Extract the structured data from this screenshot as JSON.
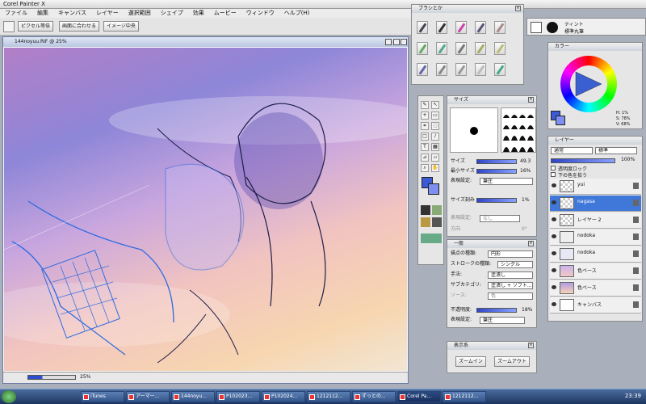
{
  "app": {
    "title": "Corel Painter X"
  },
  "menu": [
    "ファイル",
    "編集",
    "キャンバス",
    "レイヤー",
    "選択範囲",
    "シェイプ",
    "効果",
    "ムービー",
    "ウィンドウ",
    "ヘルプ(H)"
  ],
  "property_bar": {
    "btn1": "ピクセル等倍",
    "btn2": "画面に合わせる",
    "btn3": "イメージ中央"
  },
  "canvas": {
    "title": "144noyuu.RIF @ 25%",
    "zoom": "25%"
  },
  "brush_panel": {
    "title": "ブラシとか"
  },
  "dabs": {
    "label1": "ティント",
    "label2": "標準丸筆"
  },
  "size_panel": {
    "title": "サイズ",
    "size_label": "サイズ",
    "size_value": "49.3",
    "minsize_label": "最小サイズ",
    "minsize_value": "16%",
    "expr_label": "表現設定:",
    "expr_value": "筆圧",
    "minsize_pct": "最小サイズ",
    "sizestep_label": "サイズ刻み",
    "sizestep_value": "1%",
    "angle_label": "方向",
    "dir_label": "表現設定:",
    "dir_value": "なし",
    "angle_value": "0°"
  },
  "general_panel": {
    "title": "一般",
    "dab_label": "描点の種類:",
    "dab_value": "円形",
    "stroke_label": "ストロークの種類:",
    "stroke_value": "シングル",
    "method_label": "手法:",
    "method_value": "塗潰し",
    "subcat_label": "サブカテゴリ:",
    "subcat_value": "塗潰し + ソフト...",
    "source_label": "ソース:",
    "source_value": "色",
    "opacity_label": "不透明度:",
    "opacity_value": "18%",
    "opexpr_label": "表現設定:",
    "opexpr_value": "筆圧"
  },
  "display_panel": {
    "title": "表示系",
    "zoom_in": "ズームイン",
    "zoom_out": "ズームアウト"
  },
  "color_panel": {
    "title": "カラー",
    "h": "H: 1%",
    "s": "S: 78%",
    "v": "V: 68%"
  },
  "layers_panel": {
    "title": "レイヤー",
    "composite": "通常",
    "method": "標準",
    "opacity": "100%",
    "lock": "透明度ロック",
    "pick": "下の色を拾う",
    "layers": [
      {
        "name": "yui",
        "selected": false
      },
      {
        "name": "nagasa",
        "selected": true
      },
      {
        "name": "レイヤー 2",
        "selected": false
      },
      {
        "name": "nodoka",
        "selected": false
      },
      {
        "name": "nodoka",
        "selected": false
      },
      {
        "name": "色ベース",
        "selected": false
      },
      {
        "name": "色ベース",
        "selected": false
      },
      {
        "name": "キャンバス",
        "selected": false
      }
    ]
  },
  "taskbar": {
    "items": [
      "iTunes",
      "アーマー...",
      "144noyu...",
      "P102023...",
      "P102024...",
      "1212112...",
      "ずっとの...",
      "Corel Pa...",
      "1212112..."
    ],
    "clock": "23:39"
  },
  "colors": {
    "accent": "#3a5fd0",
    "selected_layer": "#3f78d8",
    "primary_color": "#3b5bd6"
  }
}
